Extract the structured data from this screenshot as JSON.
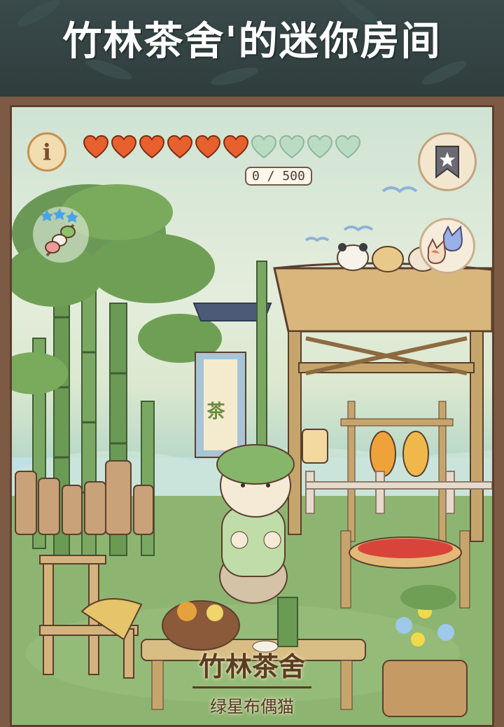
{
  "banner": {
    "title": "竹林茶舍'的迷你房间"
  },
  "hud": {
    "info_label": "i",
    "hearts_filled": 6,
    "hearts_total": 10,
    "progress_text": "0 / 500",
    "skewer_stars": 3
  },
  "scene": {
    "tea_banner_char": "茶"
  },
  "shop": {
    "name": "竹林茶舍",
    "subtitle": "绿星布偶猫"
  },
  "colors": {
    "heart_filled": "#e8602e",
    "heart_empty": "#b9dcc2",
    "frame": "#7c5a43",
    "bamboo": "#6b9a55"
  },
  "icons": [
    "info-icon",
    "heart-icon",
    "bookmark-star-icon",
    "cats-icon",
    "skewer-icon",
    "star-icon"
  ]
}
